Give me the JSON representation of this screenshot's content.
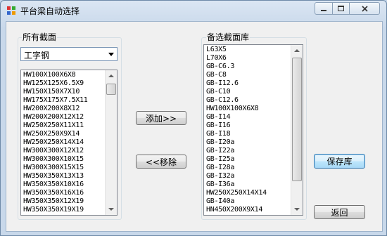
{
  "window": {
    "title": "平台梁自动选择"
  },
  "left_group": {
    "label": "所有截面",
    "combo_value": "工字钢",
    "items": [
      "HW100X100X6X8",
      "HW125X125X6.5X9",
      "HW150X150X7X10",
      "HW175X175X7.5X11",
      "HW200X200X8X12",
      "HW200X200X12X12",
      "HW250X250X11X11",
      "HW250X250X9X14",
      "HW250X250X14X14",
      "HW300X300X12X12",
      "HW300X300X10X15",
      "HW300X300X15X15",
      "HW350X350X13X13",
      "HW350X350X10X16",
      "HW350X350X16X16",
      "HW350X350X12X19",
      "HW350X350X19X19"
    ]
  },
  "right_group": {
    "label": "备选截面库",
    "items": [
      "L63X5",
      "L70X6",
      "GB-C6.3",
      "GB-C8",
      "GB-I12.6",
      "GB-C10",
      "GB-C12.6",
      "HW100X100X6X8",
      "GB-I14",
      "GB-I16",
      "GB-I18",
      "GB-I20a",
      "GB-I22a",
      "GB-I25a",
      "GB-I28a",
      "GB-I32a",
      "GB-I36a",
      "HW250X250X14X14",
      "GB-I40a",
      "HN450X200X9X14"
    ]
  },
  "buttons": {
    "add": "添加>>",
    "remove": "<<移除",
    "save": "保存库",
    "back": "返回"
  }
}
